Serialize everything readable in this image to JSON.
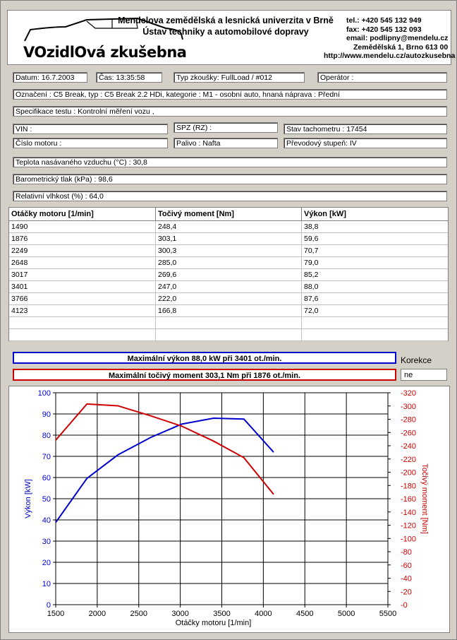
{
  "header": {
    "logo_text": "VOzidlOvá zkušebna",
    "university": "Mendelova zemědělská a lesnická univerzita v Brně",
    "institute": "Ústav techniky a automobilové dopravy",
    "contact": {
      "tel": "tel.: +420 545 132 949",
      "fax": "fax: +420 545 132 093",
      "email": "email: podlipny@mendelu.cz",
      "address": "Zemědělská 1, Brno 613 00",
      "url": "http://www.mendelu.cz/autozkusebna"
    }
  },
  "info": {
    "date": "Datum: 16.7.2003",
    "time": "Čas: 13:35:58",
    "test_type": "Typ zkoušky: FullLoad / #012",
    "operator": "Operátor :",
    "designation": "Označení : C5 Break, typ : C5 Break 2.2 HDi, kategorie : M1 - osobní auto, hnaná náprava : Přední",
    "spec": "Specifikace testu : Kontrolní měření vozu ,",
    "vin": "VIN :",
    "spz": "SPZ (RZ) :",
    "odometer": "Stav tachometru : 17454",
    "engine_no": "Číslo motoru :",
    "fuel": "Palivo : Nafta",
    "gear": "Převodový stupeň: IV",
    "intake_temp": "Teplota nasávaného vzduchu (°C) : 30,8",
    "baro": "Barometrický tlak (kPa) : 98,6",
    "humidity": "Relativní vlhkost (%) : 64,0"
  },
  "table": {
    "headers": [
      "Otáčky motoru [1/min]",
      "Točivý moment [Nm]",
      "Výkon [kW]"
    ],
    "rows": [
      [
        "1490",
        "248,4",
        "38,8"
      ],
      [
        "1876",
        "303,1",
        "59,6"
      ],
      [
        "2249",
        "300,3",
        "70,7"
      ],
      [
        "2648",
        "285,0",
        "79,0"
      ],
      [
        "3017",
        "269,6",
        "85,2"
      ],
      [
        "3401",
        "247,0",
        "88,0"
      ],
      [
        "3766",
        "222,0",
        "87,6"
      ],
      [
        "4123",
        "166,8",
        "72,0"
      ],
      [
        "",
        "",
        ""
      ],
      [
        "",
        "",
        ""
      ]
    ]
  },
  "summary": {
    "max_power": "Maximální výkon 88,0 kW při 3401 ot./min.",
    "max_torque": "Maximální točivý moment 303,1 Nm při 1876 ot./min.",
    "korekce_label": "Korekce",
    "korekce_value": "ne"
  },
  "colors": {
    "power": "#0000cc",
    "torque": "#cc0000",
    "power_box": "#0000cc",
    "torque_box": "#cc0000"
  },
  "chart_data": {
    "type": "line",
    "xlabel": "Otáčky motoru [1/min]",
    "ylabel_left": "Výkon [kW]",
    "ylabel_right": "Točivý moment [Nm]",
    "xlim": [
      1500,
      5500
    ],
    "xticks": [
      "1500",
      "2000",
      "2500",
      "3000",
      "3500",
      "4000",
      "4500",
      "5000",
      "5500"
    ],
    "ylim_left": [
      0,
      100
    ],
    "yticks_left": [
      "0",
      "10",
      "20",
      "30",
      "40",
      "50",
      "60",
      "70",
      "80",
      "90",
      "100"
    ],
    "ylim_right": [
      0,
      320
    ],
    "yticks_right": [
      "-0",
      "-20",
      "-40",
      "-60",
      "-80",
      "-100",
      "-120",
      "-140",
      "-160",
      "-180",
      "-200",
      "-220",
      "-240",
      "-260",
      "-280",
      "-300",
      "-320"
    ],
    "grid": true,
    "series": [
      {
        "axis": "left",
        "x": [
          1490,
          1876,
          2249,
          2648,
          3017,
          3401,
          3766,
          4123
        ],
        "values": [
          38.8,
          59.6,
          70.7,
          79.0,
          85.2,
          88.0,
          87.6,
          72.0
        ]
      },
      {
        "axis": "right",
        "x": [
          1490,
          1876,
          2249,
          2648,
          3017,
          3401,
          3766,
          4123
        ],
        "values": [
          248.4,
          303.1,
          300.3,
          285.0,
          269.6,
          247.0,
          222.0,
          166.8
        ]
      }
    ]
  }
}
